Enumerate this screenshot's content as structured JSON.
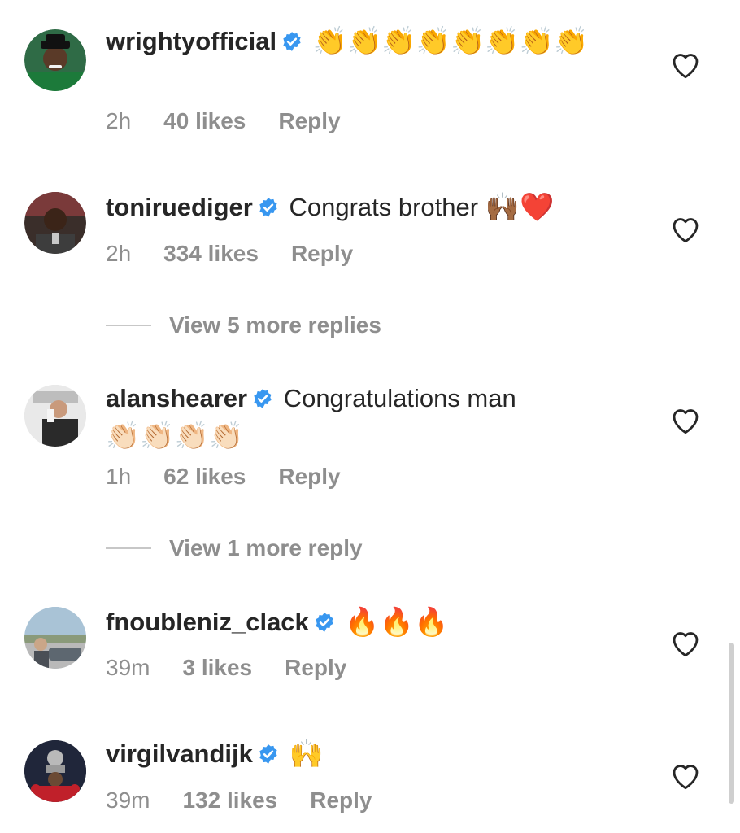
{
  "colors": {
    "text": "#262626",
    "muted": "#8e8e8e",
    "verified": "#3897f0"
  },
  "comments": [
    {
      "username": "wrightyofficial",
      "text": "",
      "emoji": "👏👏👏👏👏👏👏👏",
      "time": "2h",
      "likes": "40 likes",
      "reply": "Reply"
    },
    {
      "username": "toniruediger",
      "text": "Congrats brother",
      "emoji": "🙌🏾❤️",
      "time": "2h",
      "likes": "334 likes",
      "reply": "Reply"
    },
    {
      "username": "alanshearer",
      "text": "Congratulations man",
      "emoji": "👏🏻👏🏻👏🏻👏🏻",
      "time": "1h",
      "likes": "62 likes",
      "reply": "Reply"
    },
    {
      "username": "fnoubleniz_clack",
      "text": "",
      "emoji": "🔥🔥🔥",
      "time": "39m",
      "likes": "3 likes",
      "reply": "Reply"
    },
    {
      "username": "virgilvandijk",
      "text": "",
      "emoji": "🙌",
      "time": "39m",
      "likes": "132 likes",
      "reply": "Reply"
    }
  ],
  "view_more": [
    {
      "label": "View 5 more replies"
    },
    {
      "label": "View 1 more reply"
    }
  ]
}
